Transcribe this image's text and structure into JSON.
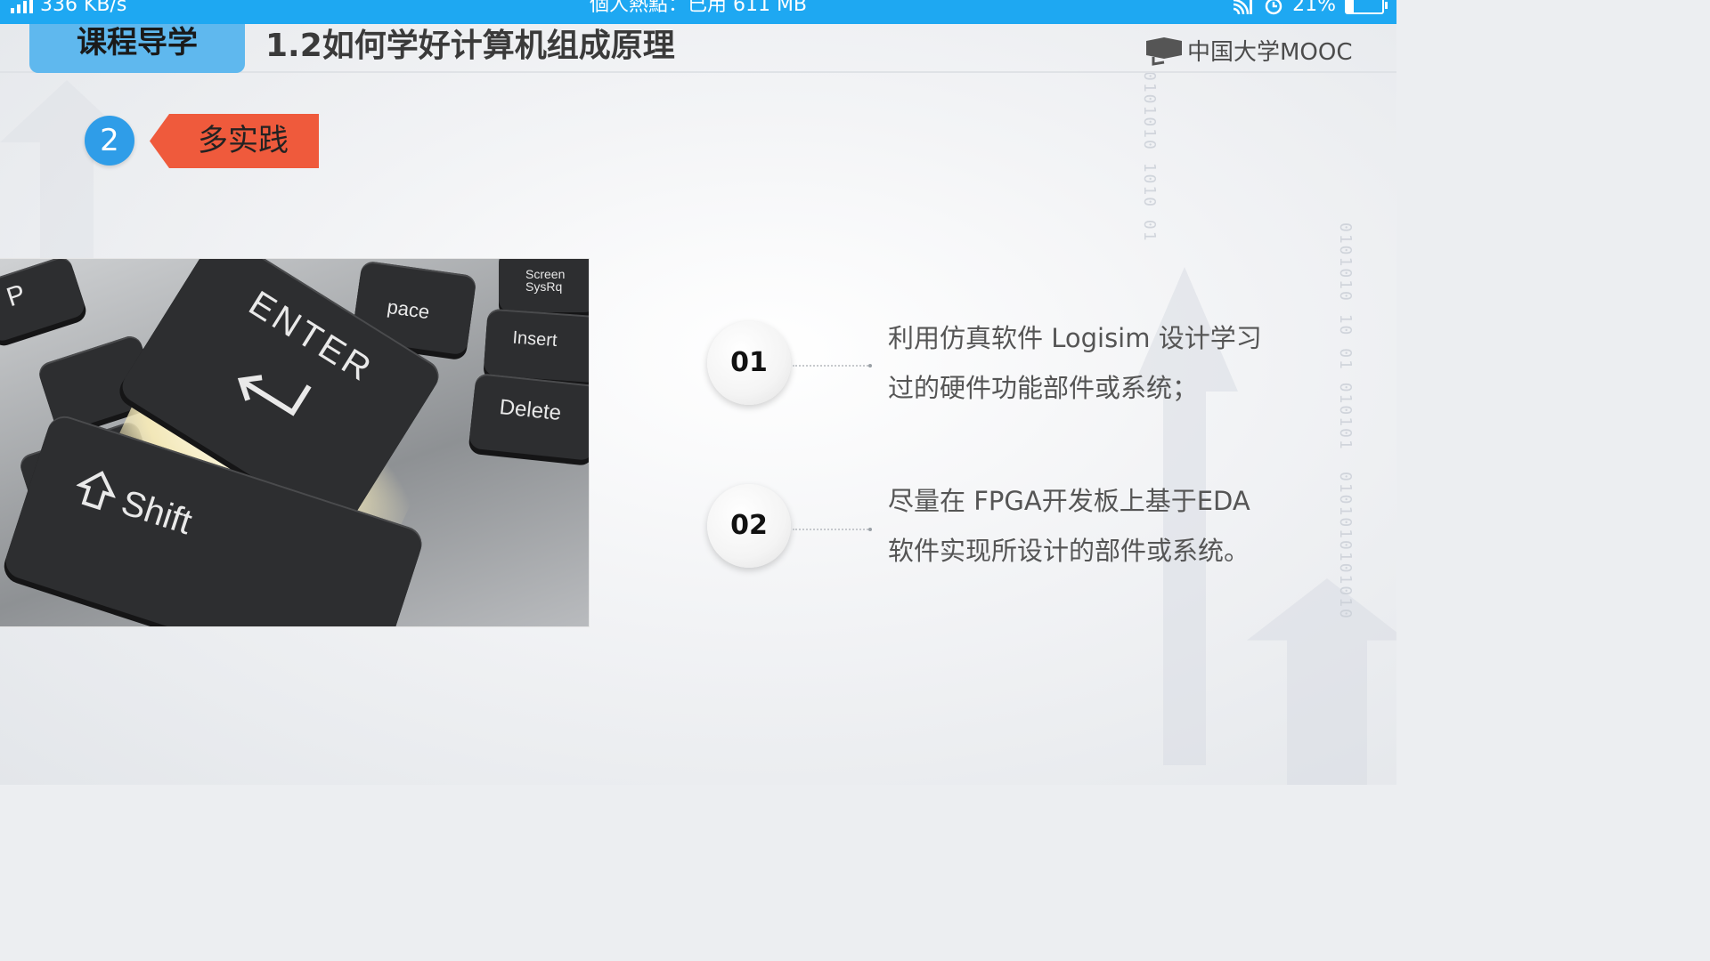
{
  "status_bar": {
    "speed": "336 KB/s",
    "hotspot": "個人熱點：已用 611 MB",
    "battery": "21%",
    "battery_level": 0.21
  },
  "header": {
    "tab_label": "课程导学",
    "title": "1.2如何学好计算机组成原理",
    "logo_text": "中国大学MOOC"
  },
  "section": {
    "number": "2",
    "label": "多实践"
  },
  "photo": {
    "keys": {
      "enter": "ENTER",
      "shift": "Shift",
      "insert": "Insert",
      "delete": "Delete",
      "space": "pace",
      "screen": "Screen SysRq",
      "p": "P"
    }
  },
  "points": [
    {
      "number": "01",
      "line1": "利用仿真软件 Logisim 设计学习",
      "line2": "过的硬件功能部件或系统；"
    },
    {
      "number": "02",
      "line1": "尽量在 FPGA开发板上基于EDA",
      "line2": "软件实现所设计的部件或系统。"
    }
  ],
  "colors": {
    "status_bar": "#1ea8f2",
    "tab_badge": "#5fb8ee",
    "number_circle": "#2f9de8",
    "section_tag": "#ef5a3c"
  }
}
